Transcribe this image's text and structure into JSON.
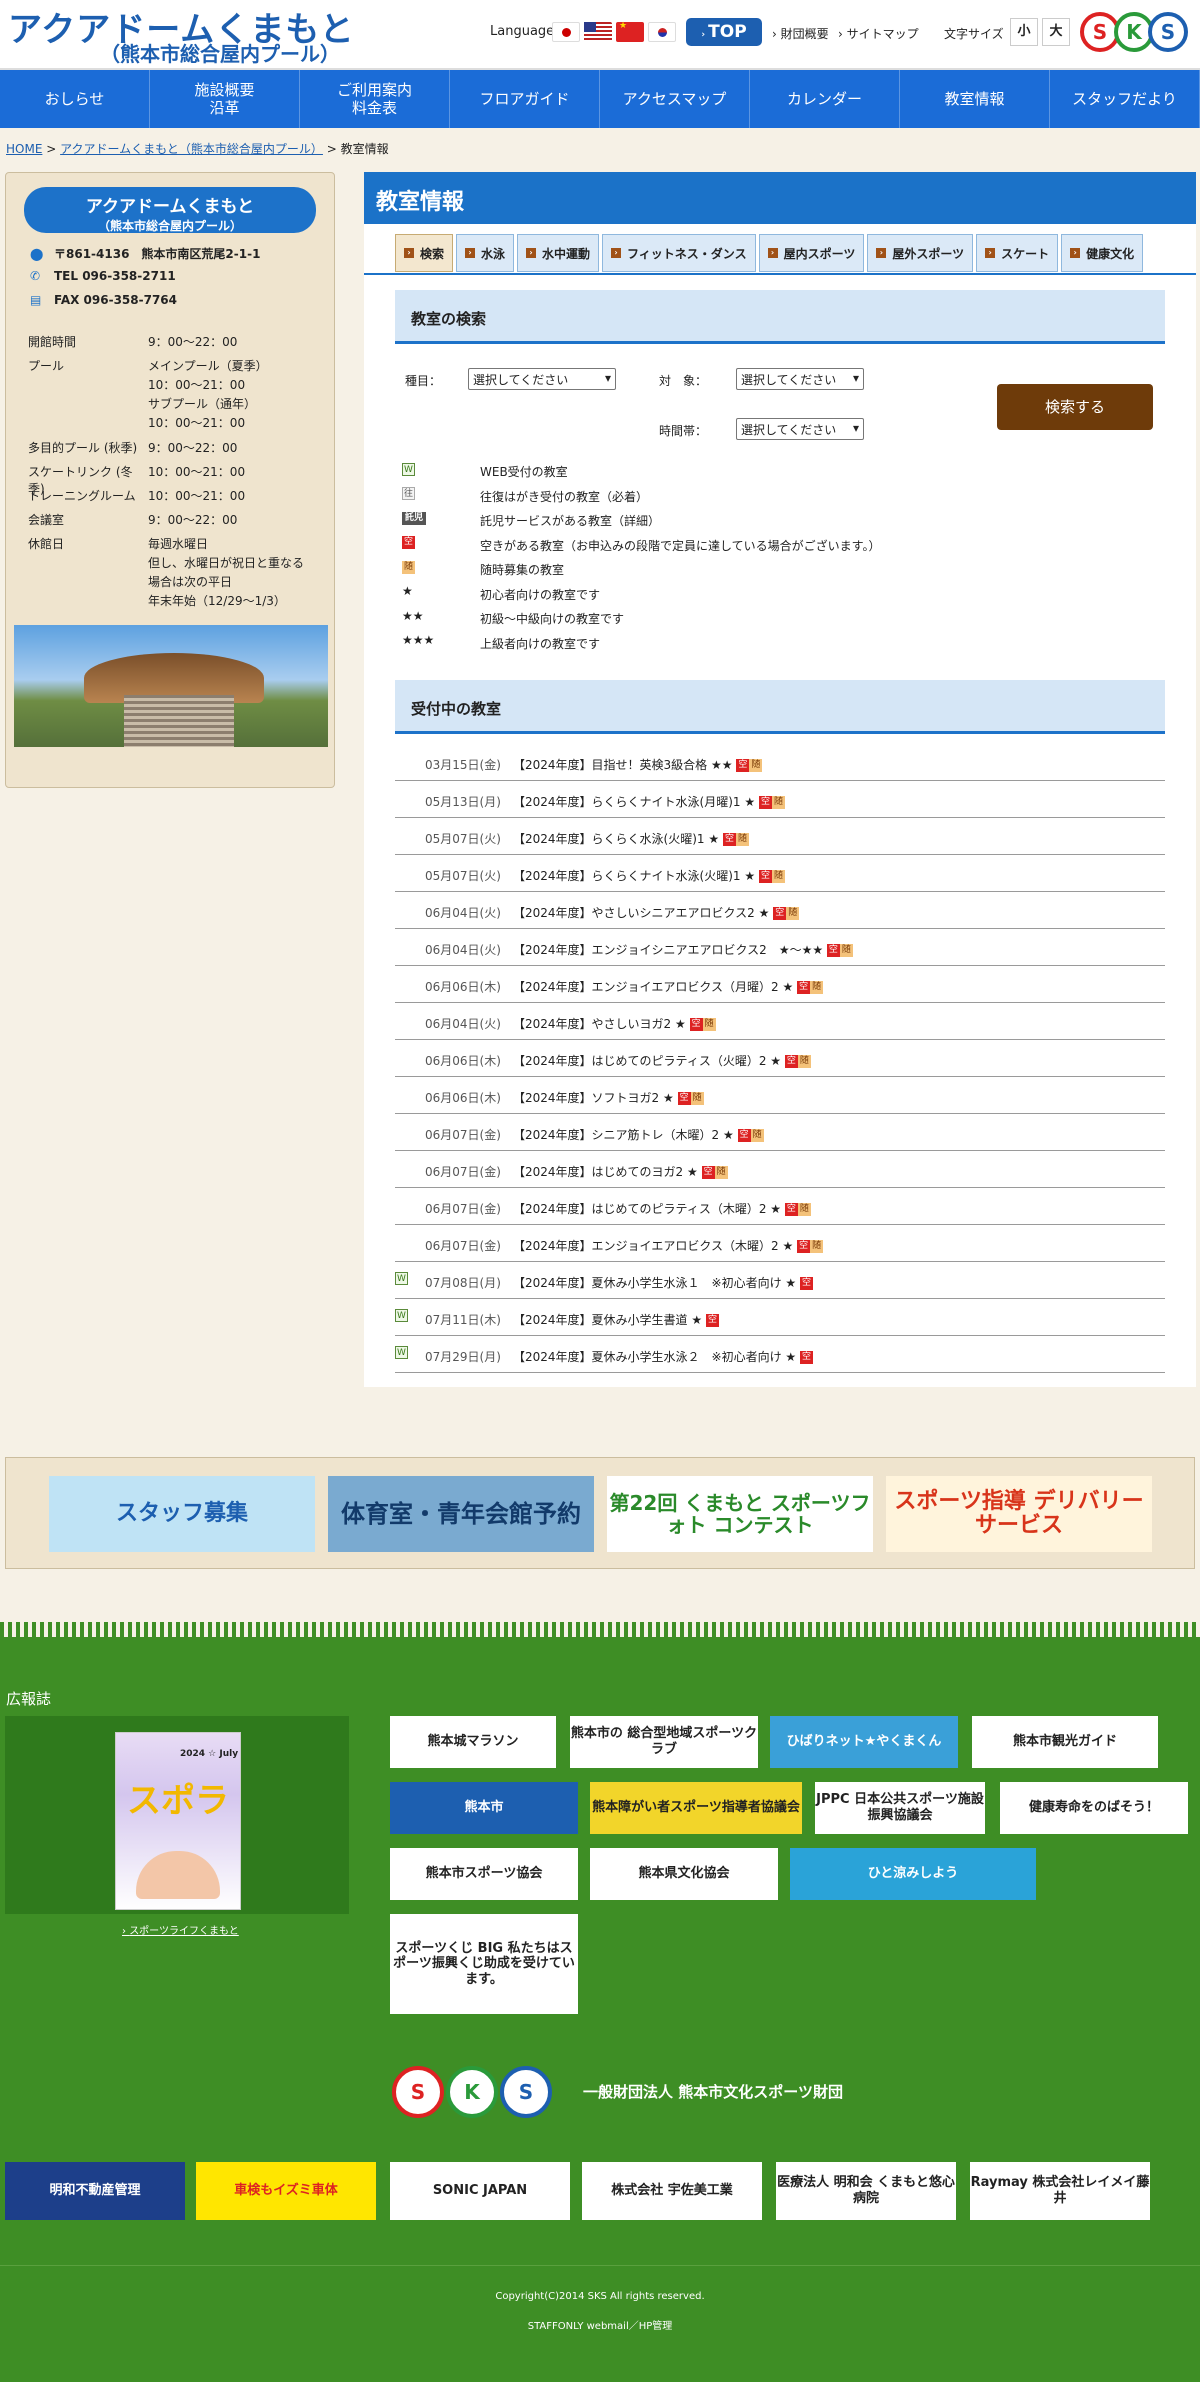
{
  "header": {
    "logo_main": "アクアドームくまもと",
    "logo_sub": "（熊本市総合屋内プール）",
    "language_label": "Language",
    "top_label": "TOP",
    "links": [
      "財団概要",
      "サイトマップ"
    ],
    "font_size_label": "文字サイズ",
    "font_small": "小",
    "font_large": "大",
    "sks": [
      "S",
      "K",
      "S"
    ]
  },
  "nav": [
    {
      "l1": "おしらせ",
      "l2": ""
    },
    {
      "l1": "施設概要",
      "l2": "沿革"
    },
    {
      "l1": "ご利用案内",
      "l2": "料金表"
    },
    {
      "l1": "フロアガイド",
      "l2": ""
    },
    {
      "l1": "アクセスマップ",
      "l2": ""
    },
    {
      "l1": "カレンダー",
      "l2": ""
    },
    {
      "l1": "教室情報",
      "l2": ""
    },
    {
      "l1": "スタッフだより",
      "l2": ""
    }
  ],
  "breadcrumb": {
    "home": "HOME",
    "sep1": ">",
    "parent": "アクアドームくまもと（熊本市総合屋内プール）",
    "sep2": ">",
    "current": "教室情報"
  },
  "sidebar": {
    "title": "アクアドームくまもと",
    "subtitle": "（熊本市総合屋内プール）",
    "address": "〒861-4136　熊本市南区荒尾2-1-1",
    "tel": "TEL 096-358-2711",
    "fax": "FAX 096-358-7764",
    "hours": [
      {
        "k": "開館時間",
        "v": [
          "9：00〜22：00"
        ]
      },
      {
        "k": "プール",
        "v": [
          "メインプール（夏季）",
          "10：00〜21：00",
          "サブプール（通年）",
          "10：00〜21：00"
        ]
      },
      {
        "k": "多目的プール (秋季)",
        "v": [
          "9：00〜22：00"
        ]
      },
      {
        "k": "スケートリンク (冬季)",
        "v": [
          "10：00〜21：00"
        ]
      },
      {
        "k": "トレーニングルーム",
        "v": [
          "10：00〜21：00"
        ]
      },
      {
        "k": "会議室",
        "v": [
          "9：00〜22：00"
        ]
      },
      {
        "k": "休館日",
        "v": [
          "毎週水曜日",
          "但し、水曜日が祝日と重なる",
          "場合は次の平日",
          "年末年始（12/29〜1/3）"
        ]
      }
    ]
  },
  "main": {
    "title": "教室情報",
    "tabs": [
      "検索",
      "水泳",
      "水中運動",
      "フィットネス・ダンス",
      "屋内スポーツ",
      "屋外スポーツ",
      "スケート",
      "健康文化"
    ],
    "search_title": "教室の検索",
    "filters": {
      "kind_label": "種目：",
      "target_label": "対　象：",
      "time_label": "時間帯：",
      "kind_value": "選択してください",
      "target_value": "選択してください",
      "time_value": "選択してください"
    },
    "search_button": "検索する",
    "legend": [
      {
        "icon": "web",
        "glyph": "W",
        "text": "WEB受付の教室"
      },
      {
        "icon": "card",
        "glyph": "往",
        "text": "往復はがき受付の教室（必着）"
      },
      {
        "icon": "child",
        "glyph": "託児",
        "text": "託児サービスがある教室（詳細）"
      },
      {
        "icon": "vac",
        "glyph": "空",
        "text": "空きがある教室（お申込みの段階で定員に達している場合がございます。）"
      },
      {
        "icon": "any",
        "glyph": "随",
        "text": "随時募集の教室"
      },
      {
        "icon": "star",
        "glyph": "★",
        "text": "初心者向けの教室です"
      },
      {
        "icon": "star",
        "glyph": "★★",
        "text": "初級〜中級向けの教室です"
      },
      {
        "icon": "star",
        "glyph": "★★★",
        "text": "上級者向けの教室です"
      }
    ],
    "open_title": "受付中の教室",
    "classes": [
      {
        "date": "03月15日(金)",
        "title": "【2024年度】目指せ！英検3級合格 ★★",
        "web": false,
        "any": true
      },
      {
        "date": "05月13日(月)",
        "title": "【2024年度】らくらくナイト水泳(月曜)1 ★",
        "web": false,
        "any": true
      },
      {
        "date": "05月07日(火)",
        "title": "【2024年度】らくらく水泳(火曜)1 ★",
        "web": false,
        "any": true
      },
      {
        "date": "05月07日(火)",
        "title": "【2024年度】らくらくナイト水泳(火曜)1 ★",
        "web": false,
        "any": true
      },
      {
        "date": "06月04日(火)",
        "title": "【2024年度】やさしいシニアエアロビクス2 ★",
        "web": false,
        "any": true
      },
      {
        "date": "06月04日(火)",
        "title": "【2024年度】エンジョイシニアエアロビクス2　★〜★★",
        "web": false,
        "any": true
      },
      {
        "date": "06月06日(木)",
        "title": "【2024年度】エンジョイエアロビクス（月曜）2 ★",
        "web": false,
        "any": true
      },
      {
        "date": "06月04日(火)",
        "title": "【2024年度】やさしいヨガ2 ★",
        "web": false,
        "any": true
      },
      {
        "date": "06月06日(木)",
        "title": "【2024年度】はじめてのピラティス（火曜）2 ★",
        "web": false,
        "any": true
      },
      {
        "date": "06月06日(木)",
        "title": "【2024年度】ソフトヨガ2 ★",
        "web": false,
        "any": true
      },
      {
        "date": "06月07日(金)",
        "title": "【2024年度】シニア筋トレ（木曜）2 ★",
        "web": false,
        "any": true
      },
      {
        "date": "06月07日(金)",
        "title": "【2024年度】はじめてのヨガ2 ★",
        "web": false,
        "any": true
      },
      {
        "date": "06月07日(金)",
        "title": "【2024年度】はじめてのピラティス（木曜）2 ★",
        "web": false,
        "any": true
      },
      {
        "date": "06月07日(金)",
        "title": "【2024年度】エンジョイエアロビクス（木曜）2 ★",
        "web": false,
        "any": true
      },
      {
        "date": "07月08日(月)",
        "title": "【2024年度】夏休み小学生水泳１　※初心者向け ★",
        "web": true,
        "any": false
      },
      {
        "date": "07月11日(木)",
        "title": "【2024年度】夏休み小学生書道 ★",
        "web": true,
        "any": false
      },
      {
        "date": "07月29日(月)",
        "title": "【2024年度】夏休み小学生水泳２　※初心者向け ★",
        "web": true,
        "any": false
      }
    ]
  },
  "banners": [
    {
      "text": "スタッフ募集",
      "bg": "#bfe3f5",
      "fg": "#1d5fb0"
    },
    {
      "text": "体育室・青年会館予約",
      "bg": "#7aaad0",
      "fg": "#123a6a"
    },
    {
      "text": "第22回 くまもと スポーツフォト コンテスト",
      "bg": "#ffffff",
      "fg": "#2a8a2a"
    },
    {
      "text": "スポーツ指導 デリバリーサービス",
      "bg": "#fff4dc",
      "fg": "#d8341a"
    }
  ],
  "footer": {
    "kouho_label": "広報誌",
    "mag_title": "スポラ",
    "mag_date": "2024 ☆ July",
    "kouho_link": "スポーツライフくまもと",
    "logos": [
      [
        "熊本城マラソン",
        "熊本市の 総合型地域スポーツクラブ",
        "ひばりネット★やくまくん",
        "熊本市観光ガイド"
      ],
      [
        "熊本市",
        "熊本障がい者スポーツ指導者協議会",
        "JPPC 日本公共スポーツ施設振興協議会",
        "健康寿命をのばそう！"
      ],
      [
        "熊本市スポーツ協会",
        "熊本県文化協会",
        "ひと涼みしよう"
      ],
      [
        "スポーツくじ BIG 私たちはスポーツ振興くじ助成を受けています。"
      ]
    ],
    "foundation": "一般財団法人 熊本市文化スポーツ財団",
    "sponsors": [
      "明和不動産管理",
      "車検もイズミ車体",
      "SONIC JAPAN",
      "株式会社 宇佐美工業",
      "医療法人 明和会 くまもと悠心病院",
      "Raymay 株式会社レイメイ藤井"
    ],
    "copyright": "Copyright(C)2014 SKS All rights reserved.",
    "staff": "STAFFONLY webmail／HP管理"
  },
  "colors": {
    "nav_blue": "#1b6cd7",
    "header_blue": "#1b72c8",
    "footer_green": "#3e8e25",
    "sks_red": "#d22",
    "sks_green": "#2a9a3a",
    "sks_blue": "#1d5fb0"
  }
}
